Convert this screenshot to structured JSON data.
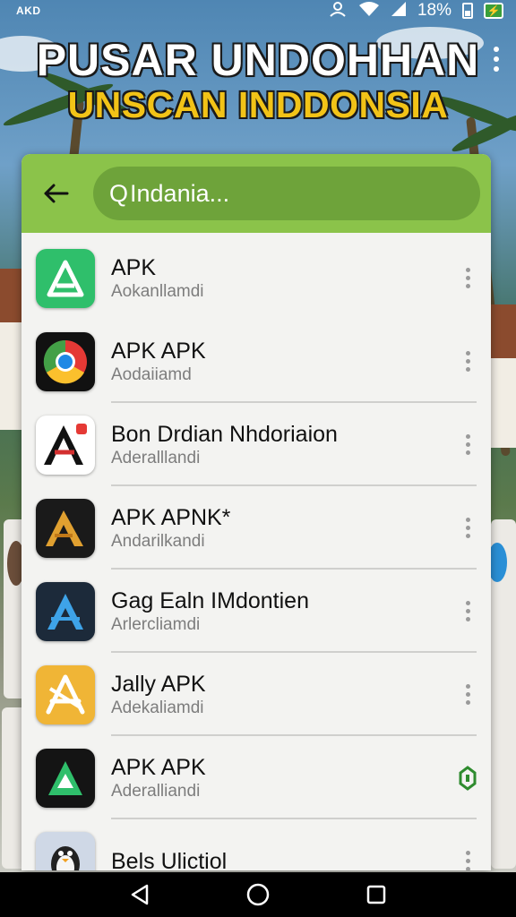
{
  "status_bar": {
    "carrier": "AKD",
    "battery_percent": "18%",
    "icons": [
      "person-icon",
      "wifi-icon",
      "signal-icon",
      "battery-icon",
      "charging-icon"
    ]
  },
  "headline": {
    "title": "PUSAR UNDOHHAN",
    "subtitle": "UNSCAN INDDONSIA"
  },
  "search": {
    "value": "Indania..."
  },
  "apps": [
    {
      "name": "APK",
      "subtitle": "Aokanllamdi",
      "icon": "apk-green-icon"
    },
    {
      "name": "APK APK",
      "subtitle": "Aodaiiamd",
      "icon": "chrome-icon"
    },
    {
      "name": "Bon Drdian Nhdoriaion",
      "subtitle": "Aderalllandi",
      "icon": "red-a-icon"
    },
    {
      "name": "APK APNK*",
      "subtitle": "Andarilkandi",
      "icon": "gold-a-icon"
    },
    {
      "name": "Gag Ealn IMdontien",
      "subtitle": "Arlercliamdi",
      "icon": "blue-a-icon"
    },
    {
      "name": "Jally APK",
      "subtitle": "Adekaliamdi",
      "icon": "yellow-a-icon"
    },
    {
      "name": "APK APK",
      "subtitle": "Aderalliandi",
      "icon": "apk-dark-icon"
    },
    {
      "name": "Bels Ulictiol",
      "subtitle": "",
      "icon": "penguin-icon"
    }
  ],
  "colors": {
    "header_green": "#8bc34a",
    "search_green": "#6ea33a",
    "title_gold": "#f2c317"
  }
}
